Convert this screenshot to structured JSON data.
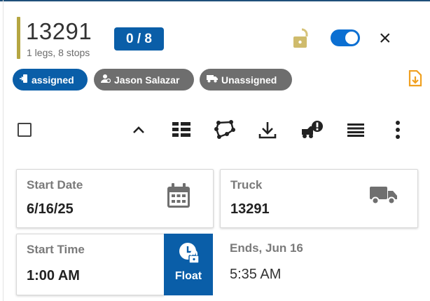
{
  "route": {
    "id": "13291",
    "summary": "1 legs, 8 stops",
    "progress_badge": "0 / 8",
    "accent_color": "#b5a642"
  },
  "header_controls": {
    "lock_icon": "unlocked-padlock-icon",
    "toggle_state": "on",
    "close_label": "×"
  },
  "status_pills": [
    {
      "label": "assigned",
      "icon": "door-arrow-icon",
      "color": "#0a5ea8"
    },
    {
      "label": "Jason Salazar",
      "icon": "driver-icon",
      "color": "#6e6e6e"
    },
    {
      "label": "Unassigned",
      "icon": "truck-icon",
      "color": "#6e6e6e"
    }
  ],
  "toolbar": {
    "icons": [
      "select-all-checkbox",
      "chevron-up-icon",
      "list-view-icon",
      "route-polygon-icon",
      "download-icon",
      "truck-alert-icon",
      "lines-menu-icon",
      "more-vert-icon"
    ]
  },
  "fields": {
    "start_date": {
      "label": "Start Date",
      "value": "6/16/25"
    },
    "truck": {
      "label": "Truck",
      "value": "13291"
    },
    "start_time": {
      "label": "Start Time",
      "value": "1:00 AM"
    },
    "float_label": "Float",
    "ends": {
      "label": "Ends, Jun 16",
      "value": "5:35 AM"
    }
  },
  "colors": {
    "primary": "#0a5ea8",
    "pill_gray": "#6e6e6e",
    "doc_orange": "#f0a020"
  }
}
